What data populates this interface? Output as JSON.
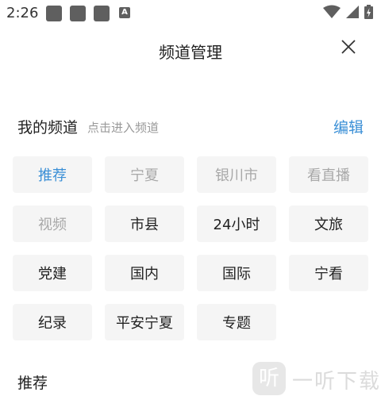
{
  "status_bar": {
    "time": "2:26",
    "app_icon_letter": "A",
    "icons": [
      "notification-square-icon",
      "notification-square-icon",
      "notification-square-icon",
      "app-a-icon",
      "wifi-icon",
      "signal-icon",
      "battery-charging-icon"
    ]
  },
  "header": {
    "title": "频道管理",
    "close_icon": "close-icon"
  },
  "my_channels": {
    "title": "我的频道",
    "hint": "点击进入频道",
    "edit_label": "编辑",
    "items": [
      {
        "label": "推荐",
        "state": "active"
      },
      {
        "label": "宁夏",
        "state": "fixed"
      },
      {
        "label": "银川市",
        "state": "fixed"
      },
      {
        "label": "看直播",
        "state": "fixed"
      },
      {
        "label": "视频",
        "state": "fixed"
      },
      {
        "label": "市县",
        "state": "normal"
      },
      {
        "label": "24小时",
        "state": "normal"
      },
      {
        "label": "文旅",
        "state": "normal"
      },
      {
        "label": "党建",
        "state": "normal"
      },
      {
        "label": "国内",
        "state": "normal"
      },
      {
        "label": "国际",
        "state": "normal"
      },
      {
        "label": "宁看",
        "state": "normal"
      },
      {
        "label": "纪录",
        "state": "normal"
      },
      {
        "label": "平安宁夏",
        "state": "normal"
      },
      {
        "label": "专题",
        "state": "normal"
      }
    ]
  },
  "recommended": {
    "title": "推荐"
  },
  "watermark": {
    "logo_char": "听",
    "text": "一听下载"
  },
  "colors": {
    "accent": "#3a8fd6",
    "chip_bg": "#f5f5f5",
    "fixed_text": "#a8a8a8"
  }
}
